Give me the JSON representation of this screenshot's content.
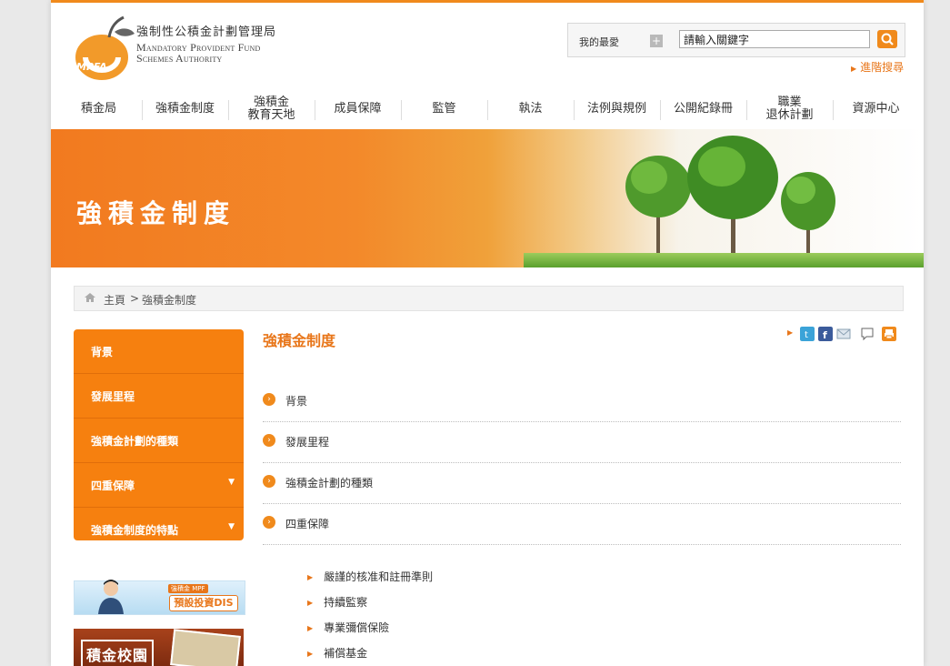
{
  "header": {
    "logo_abbr": "MPFA",
    "org_name_cn": "強制性公積金計劃管理局",
    "org_name_en_line1": "Mandatory Provident Fund",
    "org_name_en_line2": "Schemes Authority",
    "favorites_label": "我的最愛",
    "search_placeholder": "請輸入關鍵字",
    "search_value": "請輸入關鍵字",
    "advanced_search": "進階搜尋"
  },
  "nav": {
    "items": [
      {
        "label": "積金局"
      },
      {
        "label": "強積金制度"
      },
      {
        "label_line1": "強積金",
        "label_line2": "教育天地"
      },
      {
        "label": "成員保障"
      },
      {
        "label": "監管"
      },
      {
        "label": "執法"
      },
      {
        "label": "法例與規例"
      },
      {
        "label": "公開紀錄冊"
      },
      {
        "label_line1": "職業",
        "label_line2": "退休計劃"
      },
      {
        "label": "資源中心"
      }
    ]
  },
  "banner": {
    "title": "強積金制度"
  },
  "breadcrumb": {
    "home": "主頁",
    "separator": ">",
    "current": "強積金制度"
  },
  "sidebar": {
    "items": [
      {
        "label": "背景",
        "has_submenu": false
      },
      {
        "label": "發展里程",
        "has_submenu": false
      },
      {
        "label": "強積金計劃的種類",
        "has_submenu": false
      },
      {
        "label": "四重保障",
        "has_submenu": true
      },
      {
        "label": "強積金制度的特點",
        "has_submenu": true
      }
    ],
    "promo1": {
      "tag": "強積金 MPF",
      "text": "預設投資DIS"
    },
    "promo2": {
      "text": "積金校園"
    }
  },
  "content": {
    "title": "強積金制度",
    "list": [
      {
        "label": "背景"
      },
      {
        "label": "發展里程"
      },
      {
        "label": "強積金計劃的種類"
      },
      {
        "label": "四重保障"
      }
    ],
    "sub_list": [
      {
        "label": "嚴謹的核准和註冊準則"
      },
      {
        "label": "持續監察"
      },
      {
        "label": "專業彌償保險"
      },
      {
        "label": "補償基金"
      }
    ]
  },
  "colors": {
    "accent": "#f08a1c",
    "sidebar": "#f6800f",
    "twitter": "#3ba3d8",
    "facebook": "#3b5b9b"
  }
}
